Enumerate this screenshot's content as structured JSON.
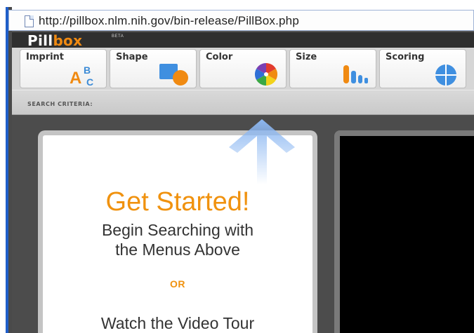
{
  "browser": {
    "url": "http://pillbox.nlm.nih.gov/bin-release/PillBox.php"
  },
  "app": {
    "logo_main": "Pill",
    "logo_accent": "box",
    "logo_tag": "BETA",
    "accent_color": "#f08a12"
  },
  "menu": {
    "tabs": [
      {
        "label": "Imprint",
        "icon": "imprint-abc-icon"
      },
      {
        "label": "Shape",
        "icon": "shape-icon"
      },
      {
        "label": "Color",
        "icon": "color-wheel-icon"
      },
      {
        "label": "Size",
        "icon": "size-bars-icon"
      },
      {
        "label": "Scoring",
        "icon": "scoring-icon"
      }
    ]
  },
  "criteria": {
    "label": "SEARCH CRITERIA:"
  },
  "start": {
    "headline": "Get Started!",
    "line1": "Begin Searching with",
    "line2": "the Menus Above",
    "or": "OR",
    "line3": "Watch the Video Tour"
  }
}
